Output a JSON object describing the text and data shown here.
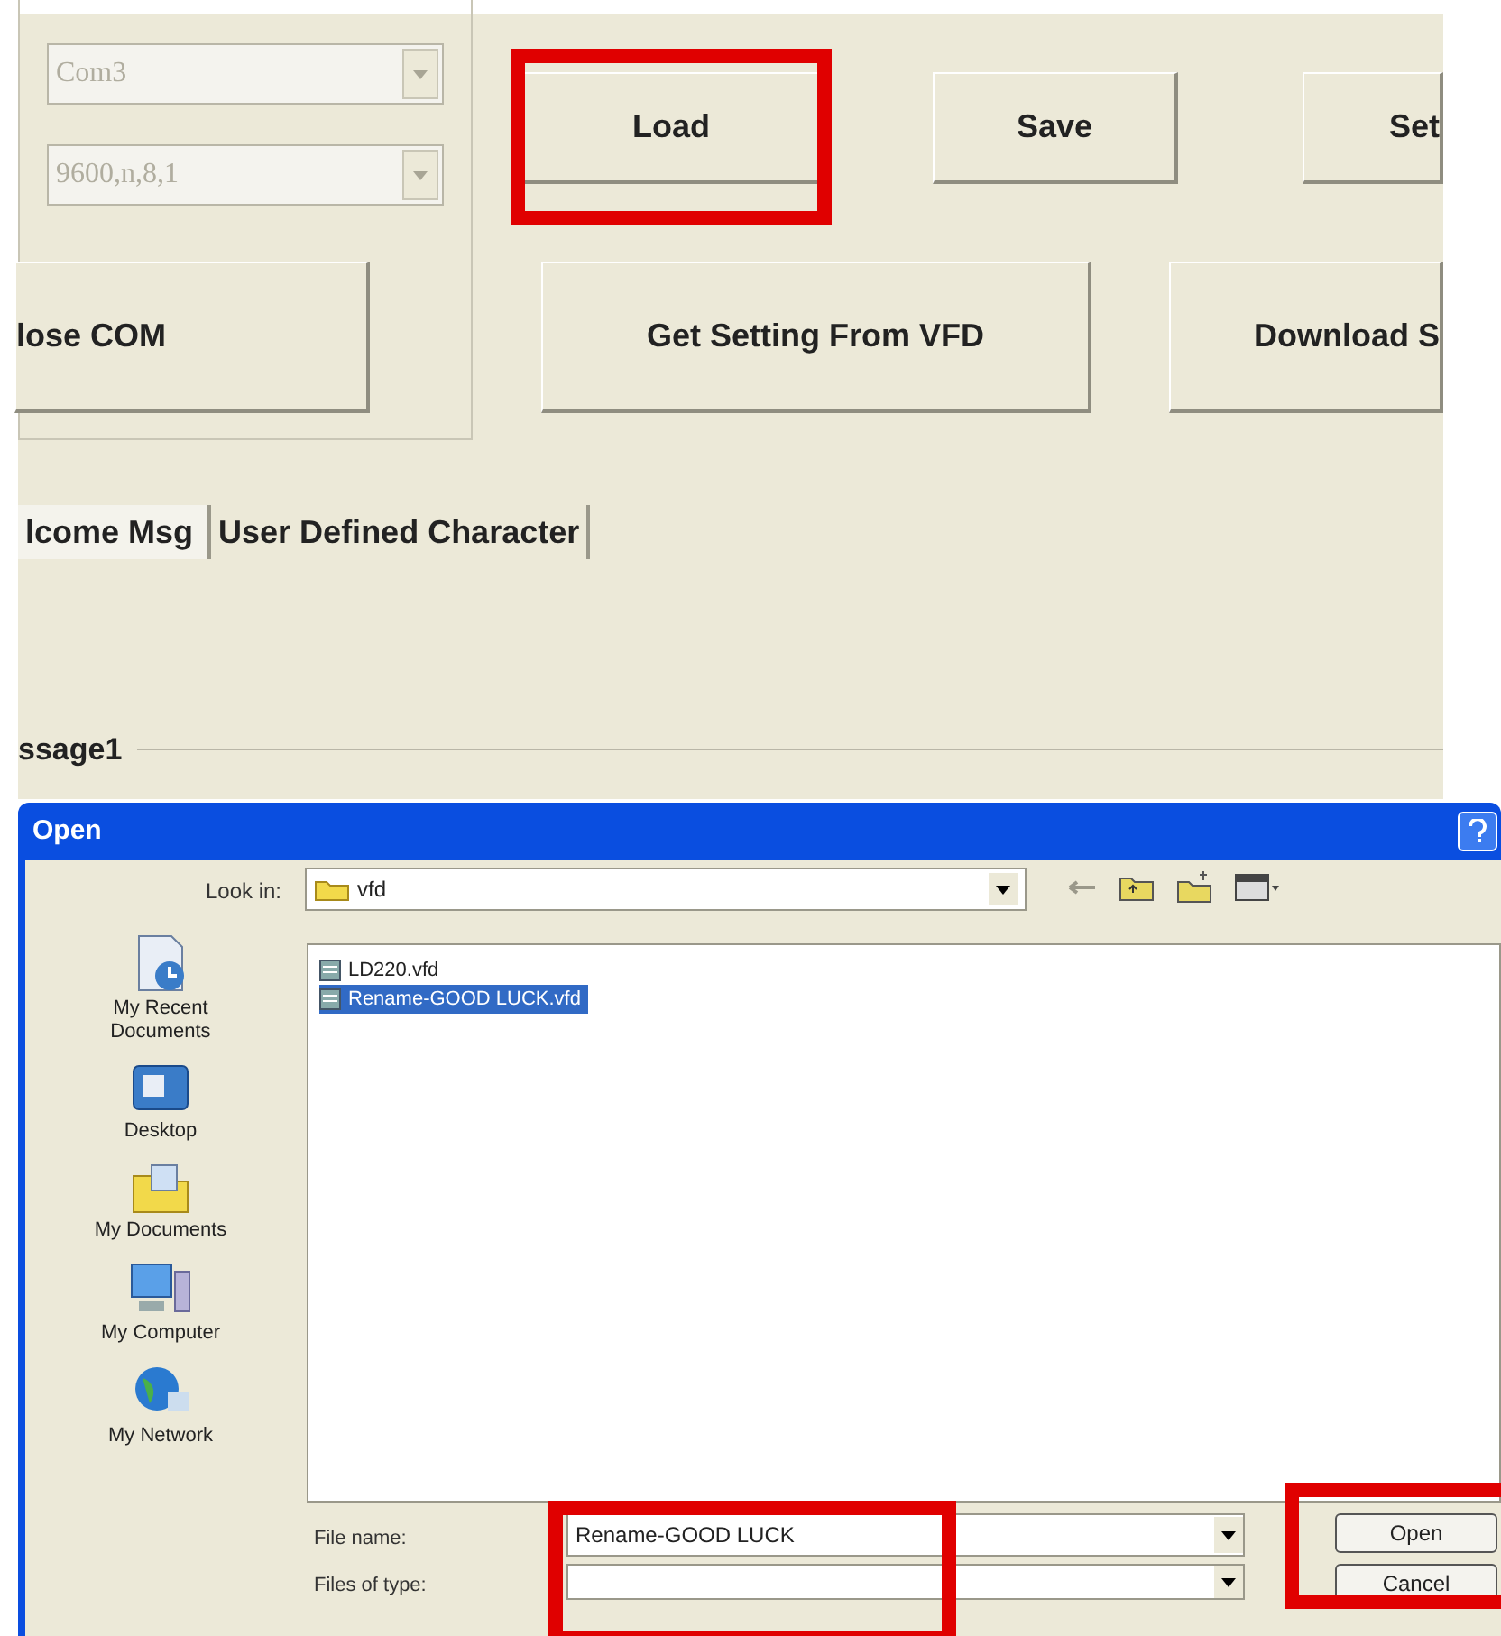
{
  "app": {
    "combos": [
      {
        "value": "Com3",
        "disabled": true
      },
      {
        "value": "9600,n,8,1",
        "disabled": true
      }
    ],
    "button_rows": [
      [
        "Load",
        "Save",
        "Set"
      ],
      [
        "lose COM",
        "Get Setting From VFD",
        "Download S"
      ]
    ],
    "tabs": [
      {
        "label": "lcome Msg",
        "selected": true
      },
      {
        "label": "User Defined Character",
        "selected": false
      }
    ],
    "group_label": "ssage1"
  },
  "dialog": {
    "title": "Open",
    "look_in_label": "Look in:",
    "look_in_value": "vfd",
    "places": [
      {
        "kind": "recent",
        "label": "My Recent Documents"
      },
      {
        "kind": "desktop",
        "label": "Desktop"
      },
      {
        "kind": "documents",
        "label": "My Documents"
      },
      {
        "kind": "computer",
        "label": "My Computer"
      },
      {
        "kind": "network",
        "label": "My Network"
      }
    ],
    "files": [
      {
        "name": "LD220.vfd",
        "selected": false
      },
      {
        "name": "Rename-GOOD LUCK.vfd",
        "selected": true
      }
    ],
    "file_name_label": "File name:",
    "file_name_value": "Rename-GOOD LUCK",
    "file_type_label": "Files of type:",
    "buttons": [
      "Open",
      "Cancel"
    ]
  }
}
